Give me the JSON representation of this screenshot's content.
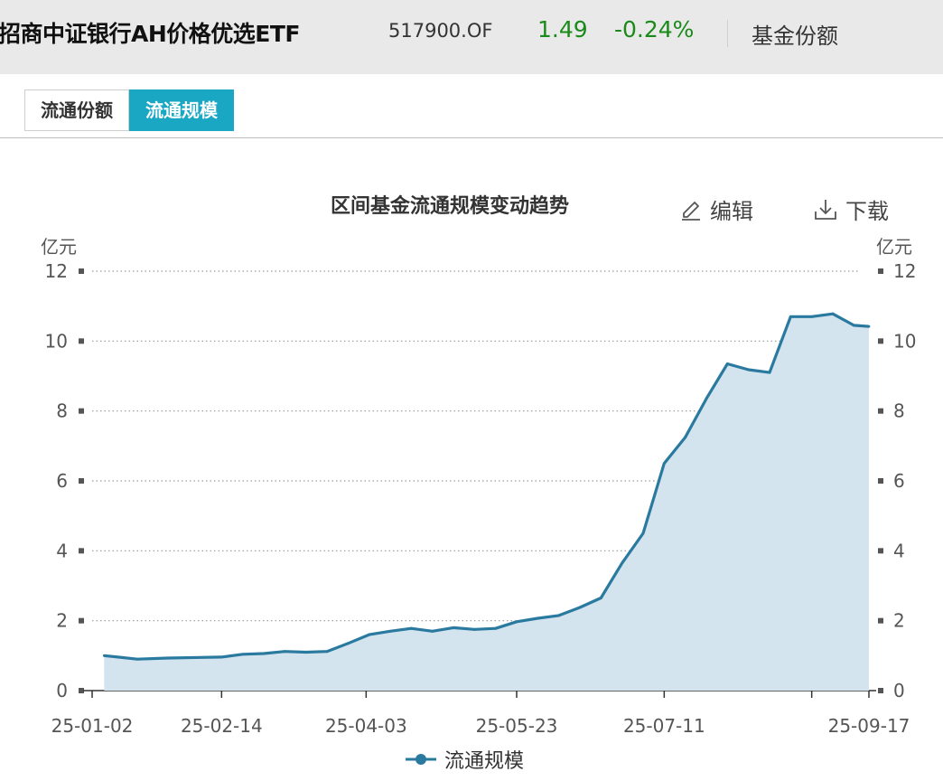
{
  "header": {
    "fund_name": "招商中证银行AH价格优选ETF",
    "code": "517900.OF",
    "price": "1.49",
    "change": "-0.24%",
    "share_label": "基金份额",
    "up_color": "#1a8a1a"
  },
  "tabs": [
    {
      "label": "流通份额",
      "active": false
    },
    {
      "label": "流通规模",
      "active": true
    }
  ],
  "toolbar": {
    "edit_label": "编辑",
    "download_label": "下载"
  },
  "colors": {
    "accent": "#1aa7c4",
    "line": "#2a7aa0",
    "area": "#d3e4ee"
  },
  "chart_data": {
    "type": "area",
    "title": "区间基金流通规模变动趋势",
    "ylabel_left": "亿元",
    "ylabel_right": "亿元",
    "ylim": [
      0,
      12
    ],
    "yticks": [
      0,
      2,
      4,
      6,
      8,
      10,
      12
    ],
    "xtick_labels": [
      "25-01-02",
      "25-02-14",
      "25-04-03",
      "25-05-23",
      "25-07-11",
      "25-09-17"
    ],
    "xlim": [
      "2025-01-02",
      "2025-09-17"
    ],
    "grid": true,
    "legend": "bottom-center",
    "series": [
      {
        "name": "流通规模",
        "x": [
          "2025-01-06",
          "2025-01-17",
          "2025-01-27",
          "2025-02-07",
          "2025-02-14",
          "2025-02-21",
          "2025-02-28",
          "2025-03-07",
          "2025-03-14",
          "2025-03-21",
          "2025-03-28",
          "2025-04-04",
          "2025-04-11",
          "2025-04-18",
          "2025-04-25",
          "2025-05-02",
          "2025-05-09",
          "2025-05-16",
          "2025-05-23",
          "2025-05-30",
          "2025-06-06",
          "2025-06-13",
          "2025-06-20",
          "2025-06-27",
          "2025-07-04",
          "2025-07-11",
          "2025-07-18",
          "2025-07-25",
          "2025-08-01",
          "2025-08-08",
          "2025-08-15",
          "2025-08-22",
          "2025-08-29",
          "2025-09-05",
          "2025-09-12",
          "2025-09-17"
        ],
        "values": [
          1.0,
          0.9,
          0.93,
          0.95,
          0.96,
          1.04,
          1.06,
          1.12,
          1.1,
          1.12,
          1.35,
          1.6,
          1.7,
          1.78,
          1.7,
          1.8,
          1.75,
          1.78,
          1.97,
          2.07,
          2.15,
          2.38,
          2.65,
          3.65,
          4.5,
          6.5,
          7.25,
          8.35,
          9.35,
          9.18,
          9.1,
          10.7,
          10.7,
          10.78,
          10.45,
          10.42
        ]
      }
    ]
  }
}
